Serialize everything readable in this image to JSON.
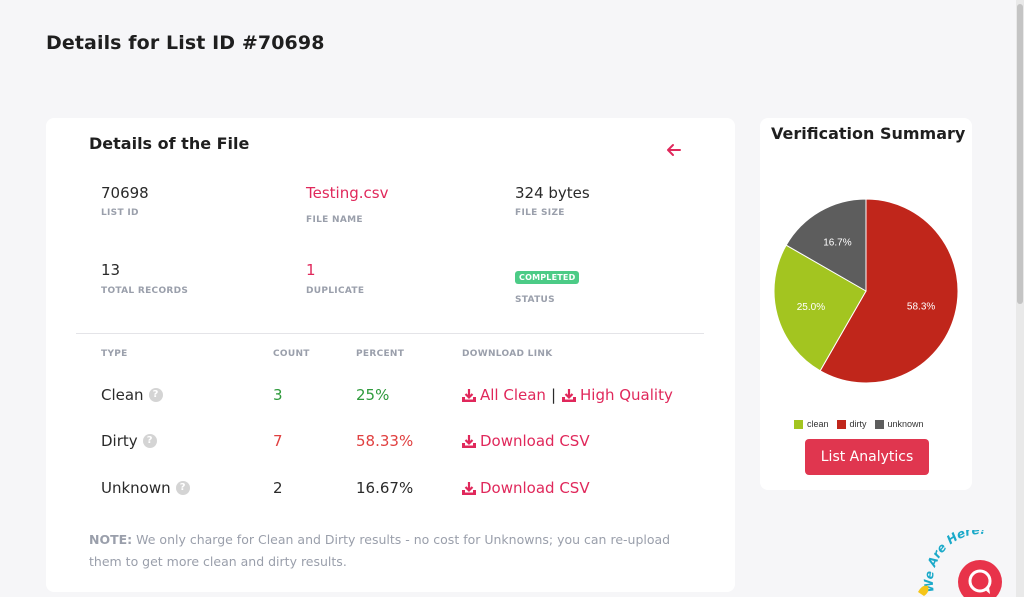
{
  "page": {
    "title": "Details for List ID #70698"
  },
  "details": {
    "title": "Details of the File",
    "fields": {
      "list_id": {
        "value": "70698",
        "label": "LIST ID"
      },
      "file_name": {
        "value": "Testing.csv",
        "label": "FILE NAME"
      },
      "file_size": {
        "value": "324 bytes",
        "label": "FILE SIZE"
      },
      "total_records": {
        "value": "13",
        "label": "TOTAL RECORDS"
      },
      "duplicate": {
        "value": "1",
        "label": "DUPLICATE"
      },
      "status": {
        "value": "COMPLETED",
        "label": "STATUS"
      }
    },
    "table": {
      "headers": {
        "type": "TYPE",
        "count": "COUNT",
        "percent": "PERCENT",
        "download": "DOWNLOAD LINK"
      },
      "rows": [
        {
          "type": "Clean",
          "count": "3",
          "percent": "25%",
          "links": [
            "All Clean",
            "High Quality"
          ]
        },
        {
          "type": "Dirty",
          "count": "7",
          "percent": "58.33%",
          "links": [
            "Download CSV"
          ]
        },
        {
          "type": "Unknown",
          "count": "2",
          "percent": "16.67%",
          "links": [
            "Download CSV"
          ]
        }
      ]
    },
    "note": {
      "bold": "NOTE:",
      "text": " We only charge for Clean and Dirty results - no cost for Unknowns; you can re-upload them to get more clean and dirty results."
    }
  },
  "summary": {
    "title": "Verification Summary",
    "button": "List Analytics",
    "chart_data": {
      "type": "pie",
      "categories": [
        "clean",
        "dirty",
        "unknown"
      ],
      "values": [
        25.0,
        58.3,
        16.7
      ],
      "labels": [
        "25.0%",
        "58.3%",
        "16.7%"
      ],
      "colors": [
        "#a3c520",
        "#c0261b",
        "#5d5d5d"
      ],
      "legend_position": "bottom"
    }
  },
  "chat_widget": {
    "text": "We Are Here!"
  },
  "icons": {
    "back": "arrow-left-icon",
    "help": "question-circle-icon",
    "download": "download-icon",
    "chat": "chat-bubble-icon"
  }
}
